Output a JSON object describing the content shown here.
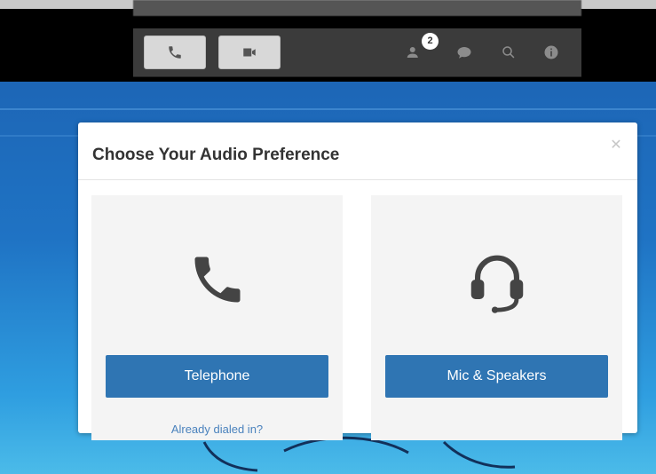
{
  "toolbar": {
    "phone_button": {
      "icon": "phone-icon"
    },
    "video_button": {
      "icon": "video-camera-icon"
    },
    "participants": {
      "icon": "participants-icon",
      "badge_count": "2"
    },
    "chat": {
      "icon": "chat-icon"
    },
    "search": {
      "icon": "search-icon"
    },
    "info": {
      "icon": "info-icon"
    }
  },
  "dialog": {
    "title": "Choose Your Audio Preference",
    "close_icon": "close-icon",
    "options": [
      {
        "icon": "telephone-handset-icon",
        "button_label": "Telephone",
        "link_label": "Already dialed in?"
      },
      {
        "icon": "headset-icon",
        "button_label": "Mic & Speakers"
      }
    ]
  },
  "colors": {
    "primary_button": "#2f75b3",
    "link": "#4a82bd",
    "toolbar_bg": "#3b3b3b",
    "desktop_bg": "#1f73c4"
  }
}
